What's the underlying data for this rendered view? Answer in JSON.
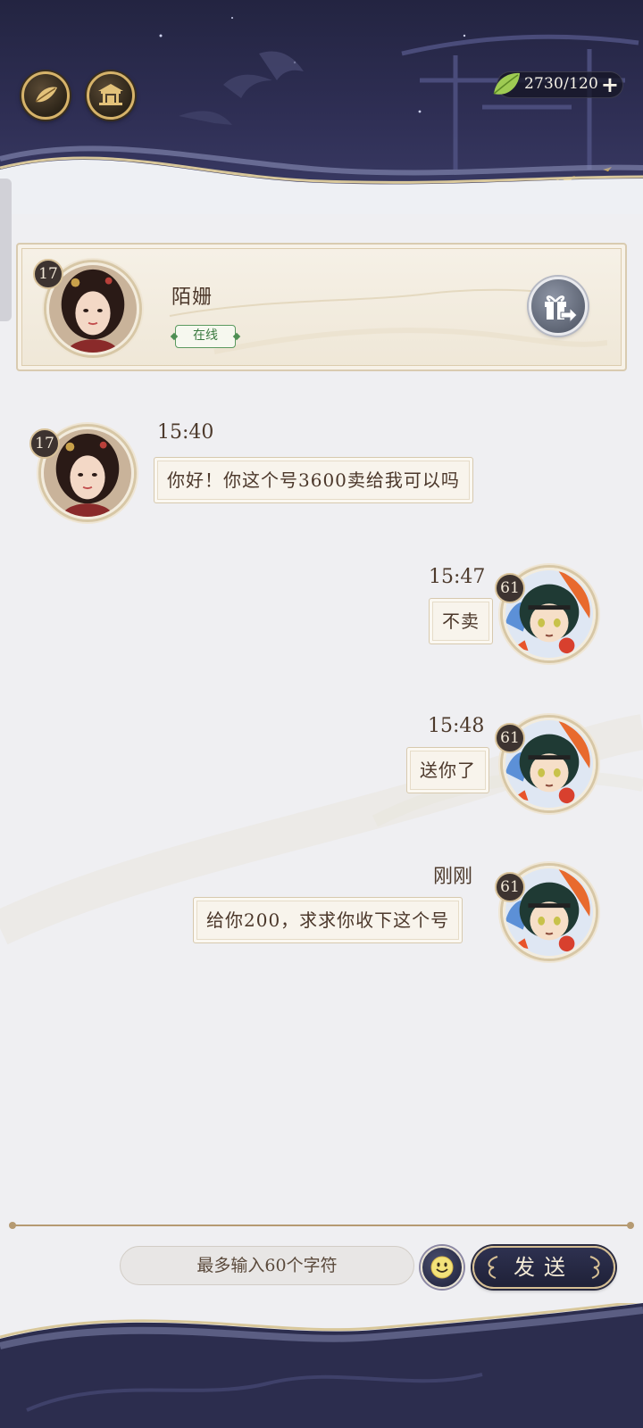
{
  "header": {
    "buttons": [
      {
        "icon": "leaf-emblem-icon"
      },
      {
        "icon": "pavilion-icon"
      }
    ],
    "currency": {
      "icon": "jade-leaf-icon",
      "value": "2730/120",
      "plus": "+"
    }
  },
  "profile": {
    "level": "17",
    "name": "陌姗",
    "status": "在线",
    "gift_icon": "gift-send-icon"
  },
  "messages": [
    {
      "side": "left",
      "time": "15:40",
      "text": "你好！你这个号3600卖给我可以吗",
      "level": "17"
    },
    {
      "side": "right",
      "time": "15:47",
      "text": "不卖",
      "level": "61"
    },
    {
      "side": "right",
      "time": "15:48",
      "text": "送你了",
      "level": "61"
    },
    {
      "side": "right",
      "time": "刚刚",
      "text": "给你200，求求你收下这个号",
      "level": "61"
    }
  ],
  "input": {
    "placeholder": "最多输入60个字符",
    "emoji_icon": "smiley-icon",
    "send_label": "发送"
  },
  "colors": {
    "header_bg": "#2f2f55",
    "card_bg": "#f6f1e7",
    "bubble_border": "#d7c9ae",
    "text_brown": "#4b372a",
    "online_green": "#3b7a40",
    "send_bg": "#1f2138",
    "gold": "#d6b36a"
  }
}
